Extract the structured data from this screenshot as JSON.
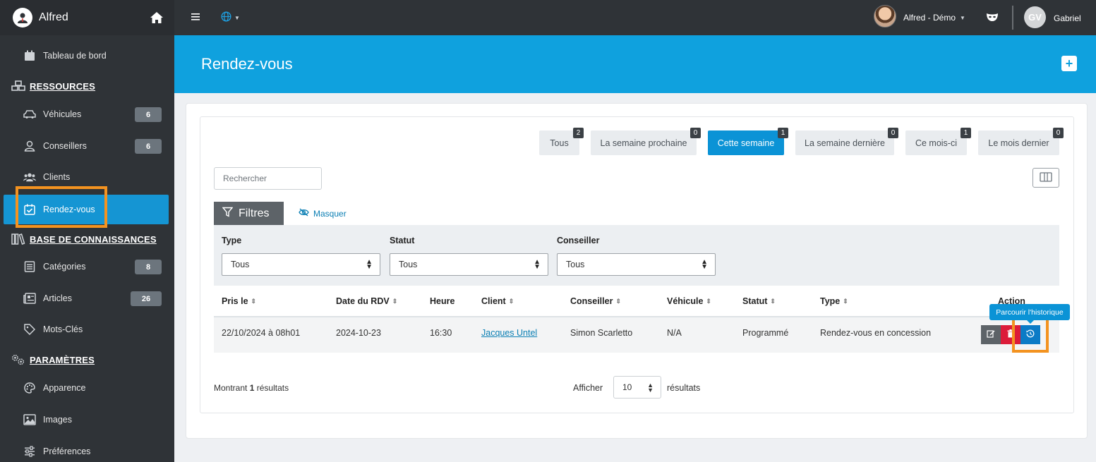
{
  "app": {
    "name": "Alfred"
  },
  "sidebar": {
    "items": [
      {
        "label": "Tableau de bord",
        "icon": "calendar-icon"
      },
      {
        "label": "Véhicules",
        "badge": "6",
        "icon": "car-icon"
      },
      {
        "label": "Conseillers",
        "badge": "6",
        "icon": "user-icon"
      },
      {
        "label": "Clients",
        "icon": "users-icon"
      },
      {
        "label": "Rendez-vous",
        "icon": "calendar-check-icon",
        "active": true
      },
      {
        "label": "Catégories",
        "badge": "8",
        "icon": "list-icon"
      },
      {
        "label": "Articles",
        "badge": "26",
        "icon": "newspaper-icon"
      },
      {
        "label": "Mots-Clés",
        "icon": "tag-icon"
      },
      {
        "label": "Apparence",
        "icon": "palette-icon"
      },
      {
        "label": "Images",
        "icon": "image-icon"
      },
      {
        "label": "Préférences",
        "icon": "sliders-icon"
      }
    ],
    "sections": [
      {
        "label": "RESSOURCES",
        "icon": "cubes-icon"
      },
      {
        "label": "BASE DE CONNAISSANCES",
        "icon": "books-icon"
      },
      {
        "label": "PARAMÈTRES",
        "icon": "gears-icon"
      }
    ]
  },
  "topbar": {
    "account": "Alfred - Démo",
    "user_initials": "GV",
    "user_name": "Gabriel"
  },
  "header": {
    "title": "Rendez-vous"
  },
  "periods": [
    {
      "label": "Tous",
      "count": "2"
    },
    {
      "label": "La semaine prochaine",
      "count": "0"
    },
    {
      "label": "Cette semaine",
      "count": "1",
      "active": true
    },
    {
      "label": "La semaine dernière",
      "count": "0"
    },
    {
      "label": "Ce mois-ci",
      "count": "1"
    },
    {
      "label": "Le mois dernier",
      "count": "0"
    }
  ],
  "search": {
    "placeholder": "Rechercher"
  },
  "filters": {
    "tab_label": "Filtres",
    "hide_label": "Masquer",
    "fields": [
      {
        "label": "Type",
        "value": "Tous"
      },
      {
        "label": "Statut",
        "value": "Tous"
      },
      {
        "label": "Conseiller",
        "value": "Tous"
      }
    ]
  },
  "table": {
    "columns": [
      "Pris le",
      "Date du RDV",
      "Heure",
      "Client",
      "Conseiller",
      "Véhicule",
      "Statut",
      "Type",
      "Action"
    ],
    "rows": [
      [
        "22/10/2024 à 08h01",
        "2024-10-23",
        "16:30",
        "Jacques Untel",
        "Simon Scarletto",
        "N/A",
        "Programmé",
        "Rendez-vous en concession"
      ]
    ],
    "tooltip": "Parcourir l'historique"
  },
  "footer": {
    "showing_prefix": "Montrant",
    "showing_count": "1",
    "showing_suffix": "résultats",
    "per_page_label": "Afficher",
    "per_page_value": "10",
    "per_page_suffix": "résultats"
  },
  "colors": {
    "accent": "#0fa1de",
    "sidebar": "#2f3337",
    "highlight": "#f39320",
    "danger": "#dc1c3a"
  }
}
